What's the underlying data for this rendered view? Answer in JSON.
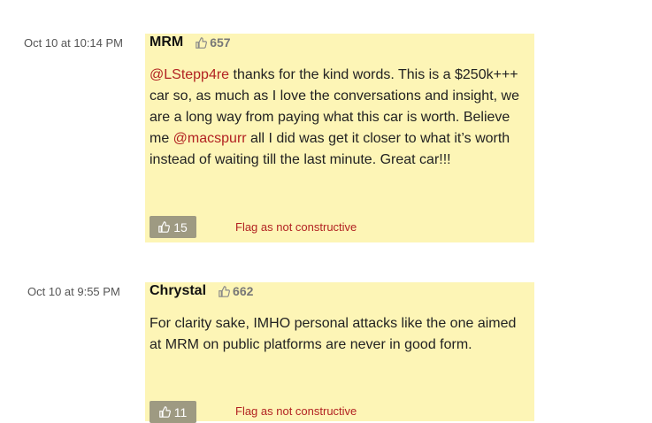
{
  "comments": [
    {
      "timestamp": "Oct 10 at 10:14 PM",
      "author": "MRM",
      "reputation": "657",
      "body": {
        "mention1": "@LStepp4re",
        "part1": " thanks for the kind words. This is a $250k+++ car so, as much as I love the conversations and insight, we are a long way from paying what this car is worth. Believe me ",
        "mention2": "@macspurr",
        "part2": " all I did was get it closer to what it’s worth instead of waiting till the last minute. Great car!!!"
      },
      "likes": "15",
      "flag_label": "Flag as not constructive"
    },
    {
      "timestamp": "Oct 10 at 9:55 PM",
      "author": "Chrystal",
      "reputation": "662",
      "body": {
        "part1": "For clarity sake, IMHO personal attacks like the one aimed at MRM on public platforms are never in good form."
      },
      "likes": "11",
      "flag_label": "Flag as not constructive"
    }
  ],
  "icons": {
    "like": "thumbs-up-icon",
    "reputation": "thumbs-up-icon"
  },
  "colors": {
    "card_bg": "#fdf5b6",
    "mention": "#b22222",
    "flag": "#b22222",
    "like_button": "#9e9a82"
  }
}
